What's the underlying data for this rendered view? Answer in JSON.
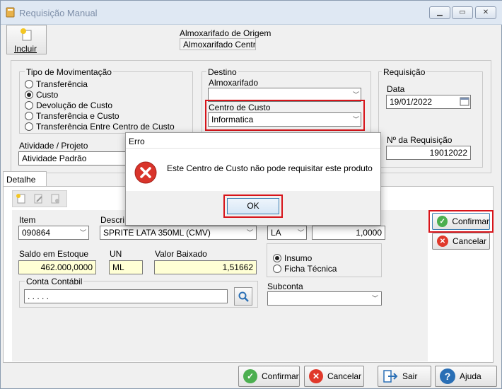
{
  "window": {
    "title": "Requisição Manual",
    "controls": {
      "minimize": "▁",
      "restore": "▭",
      "close": "✕"
    }
  },
  "toolbar": {
    "incluir": "Incluir"
  },
  "origem": {
    "label": "Almoxarifado de Origem",
    "value": "Almoxarifado Central"
  },
  "tipo": {
    "label": "Tipo de Movimentação",
    "options": [
      "Transferência",
      "Custo",
      "Devolução de Custo",
      "Transferência e Custo",
      "Transferência Entre Centro de Custo"
    ],
    "selected": "Custo"
  },
  "destino": {
    "label": "Destino",
    "almox_label": "Almoxarifado",
    "almox_value": "",
    "cc_label": "Centro de Custo",
    "cc_value": "Informatica"
  },
  "requisicao": {
    "label": "Requisição",
    "data_label": "Data",
    "data_value": "19/01/2022",
    "num_label": "Nº  da Requisição",
    "num_value": "19012022"
  },
  "atividade": {
    "label": "Atividade / Projeto",
    "value": "Atividade Padrão"
  },
  "tabs": {
    "detalhe": "Detalhe"
  },
  "detail": {
    "item_label": "Item",
    "item_value": "090864",
    "desc_label": "Descri",
    "desc_value": "SPRITE LATA 350ML (CMV)",
    "unit_combo": "LA",
    "qty_value": "1,0000",
    "saldo_label": "Saldo em Estoque",
    "saldo_value": "462.000,0000",
    "un_label": "UN",
    "un_value": "ML",
    "valor_label": "Valor Baixado",
    "valor_value": "1,51662",
    "conta_label": "Conta Contábil",
    "conta_value": ". . . . .",
    "insumo": "Insumo",
    "ficha": "Ficha Técnica",
    "subconta_label": "Subconta",
    "subconta_value": ""
  },
  "side_buttons": {
    "confirmar": "Confirmar",
    "cancelar": "Cancelar"
  },
  "bottom_buttons": {
    "confirmar": "Confirmar",
    "cancelar": "Cancelar",
    "sair": "Sair",
    "ajuda": "Ajuda"
  },
  "dialog": {
    "title": "Erro",
    "message": "Este Centro de Custo não pode requisitar este produto",
    "ok": "OK"
  },
  "colors": {
    "highlight": "#d7141a",
    "accent": "#dfe8f3"
  }
}
